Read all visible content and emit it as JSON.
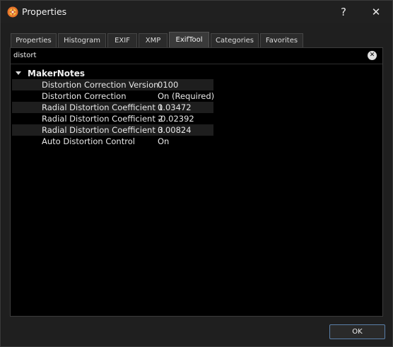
{
  "window": {
    "title": "Properties",
    "help_glyph": "?",
    "close_glyph": "✕"
  },
  "tabs": [
    {
      "label": "Properties",
      "active": false
    },
    {
      "label": "Histogram",
      "active": false
    },
    {
      "label": "EXIF",
      "active": false
    },
    {
      "label": "XMP",
      "active": false
    },
    {
      "label": "ExifTool",
      "active": true
    },
    {
      "label": "Categories",
      "active": false
    },
    {
      "label": "Favorites",
      "active": false
    }
  ],
  "search": {
    "value": "distort",
    "clear_glyph": "✕"
  },
  "tree": {
    "group": "MakerNotes",
    "rows": [
      {
        "name": "Distortion Correction Version",
        "value": "0100"
      },
      {
        "name": "Distortion Correction",
        "value": "On (Required)"
      },
      {
        "name": "Radial Distortion Coefficient 1",
        "value": "0.03472"
      },
      {
        "name": "Radial Distortion Coefficient 2",
        "value": "-0.02392"
      },
      {
        "name": "Radial Distortion Coefficient 3",
        "value": "0.00824"
      },
      {
        "name": "Auto Distortion Control",
        "value": "On"
      }
    ]
  },
  "footer": {
    "ok_label": "OK"
  }
}
